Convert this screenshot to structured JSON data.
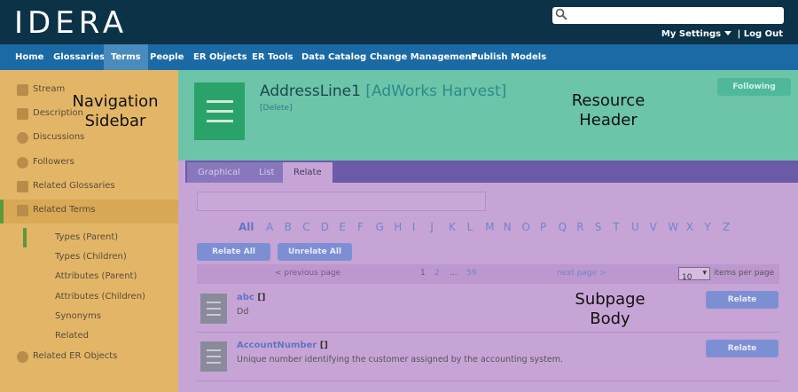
{
  "header": {
    "logo": "IDERA",
    "search_placeholder": "",
    "my_settings": "My Settings",
    "separator": "|",
    "logout": "Log Out"
  },
  "nav": {
    "items": [
      "Home",
      "Glossaries",
      "Terms",
      "People",
      "ER Objects",
      "ER Tools",
      "Data Catalog",
      "Change Management",
      "Publish Models"
    ],
    "active": "Terms"
  },
  "sidebar": {
    "items": [
      "Stream",
      "Description",
      "Discussions",
      "Followers",
      "Related Glossaries",
      "Related Terms"
    ],
    "sub_items": [
      "Types (Parent)",
      "Types (Children)",
      "Attributes (Parent)",
      "Attributes (Children)",
      "Synonyms",
      "Related"
    ],
    "last_item": "Related ER Objects",
    "overlay_label_line1": "Navigation",
    "overlay_label_line2": "Sidebar"
  },
  "resource": {
    "name": "AddressLine1",
    "glossary": "[AdWorks Harvest]",
    "delete": "[Delete]",
    "following": "Following",
    "overlay_label_line1": "Resource",
    "overlay_label_line2": "Header"
  },
  "subpage": {
    "tabs": [
      "Graphical",
      "List",
      "Relate"
    ],
    "active_tab": "Relate",
    "filter_value": "",
    "alphabet": [
      "All",
      "A",
      "B",
      "C",
      "D",
      "E",
      "F",
      "G",
      "H",
      "I",
      "J",
      "K",
      "L",
      "M",
      "N",
      "O",
      "P",
      "Q",
      "R",
      "S",
      "T",
      "U",
      "V",
      "W",
      "X",
      "Y",
      "Z"
    ],
    "relate_all": "Relate All",
    "unrelate_all": "Unrelate All",
    "pager": {
      "prev": "< previous page",
      "page1": "1",
      "page2": "2",
      "ellipsis": "...",
      "last": "59",
      "next": "next page >",
      "per_page_value": "10",
      "per_page_label": "items per page"
    },
    "rows": [
      {
        "title": "abc",
        "brackets": "[]",
        "desc": "Dd",
        "action": "Relate"
      },
      {
        "title": "AccountNumber",
        "brackets": "[]",
        "desc": "Unique number identifying the customer assigned by the accounting system.",
        "action": "Relate"
      }
    ],
    "overlay_label_line1": "Subpage",
    "overlay_label_line2": "Body"
  },
  "colors": {
    "topbar": "#0c3248",
    "navbar": "#1b6aa5",
    "sidebar_overlay": "#e3b667",
    "header_overlay": "#6cc4a9",
    "body_overlay": "#c7a4d6"
  }
}
